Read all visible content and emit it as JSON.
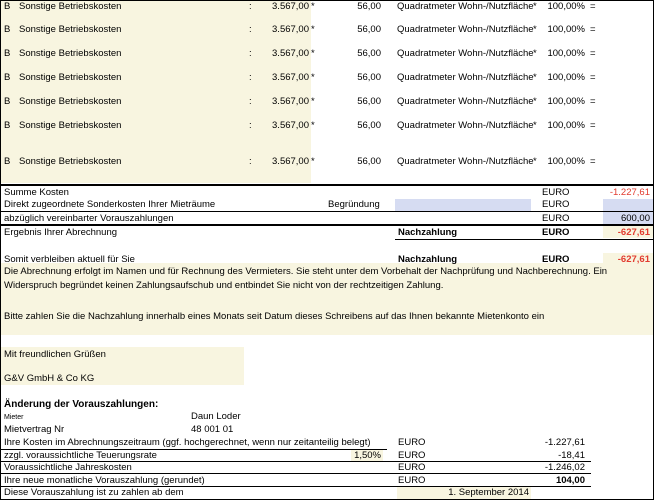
{
  "cost_rows": [
    {
      "code": "B",
      "label": "Sonstige Betriebskosten",
      "colon": ":",
      "amount": "3.567,00",
      "op": "*",
      "factor": "56,00",
      "basis": "Quadratmeter Wohn-/Nutzfläche",
      "op2": "*",
      "percent": "100,00%",
      "eq": "="
    },
    {
      "code": "B",
      "label": "Sonstige Betriebskosten",
      "colon": ":",
      "amount": "3.567,00",
      "op": "*",
      "factor": "56,00",
      "basis": "Quadratmeter Wohn-/Nutzfläche",
      "op2": "*",
      "percent": "100,00%",
      "eq": "="
    },
    {
      "code": "B",
      "label": "Sonstige Betriebskosten",
      "colon": ":",
      "amount": "3.567,00",
      "op": "*",
      "factor": "56,00",
      "basis": "Quadratmeter Wohn-/Nutzfläche",
      "op2": "*",
      "percent": "100,00%",
      "eq": "="
    },
    {
      "code": "B",
      "label": "Sonstige Betriebskosten",
      "colon": ":",
      "amount": "3.567,00",
      "op": "*",
      "factor": "56,00",
      "basis": "Quadratmeter Wohn-/Nutzfläche",
      "op2": "*",
      "percent": "100,00%",
      "eq": "="
    },
    {
      "code": "B",
      "label": "Sonstige Betriebskosten",
      "colon": ":",
      "amount": "3.567,00",
      "op": "*",
      "factor": "56,00",
      "basis": "Quadratmeter Wohn-/Nutzfläche",
      "op2": "*",
      "percent": "100,00%",
      "eq": "="
    },
    {
      "code": "B",
      "label": "Sonstige Betriebskosten",
      "colon": ":",
      "amount": "3.567,00",
      "op": "*",
      "factor": "56,00",
      "basis": "Quadratmeter Wohn-/Nutzfläche",
      "op2": "*",
      "percent": "100,00%",
      "eq": "="
    },
    {
      "code": "B",
      "label": "Sonstige Betriebskosten",
      "colon": ":",
      "amount": "3.567,00",
      "op": "*",
      "factor": "56,00",
      "basis": "Quadratmeter Wohn-/Nutzfläche",
      "op2": "*",
      "percent": "100,00%",
      "eq": "="
    }
  ],
  "summary": {
    "sum_label": "Summe Kosten",
    "sum_currency": "EURO",
    "sum_value": "-1.227,61",
    "direct_label": "Direkt zugeordnete Sonderkosten Ihrer Mieträume",
    "reason_label": "Begründung",
    "direct_currency": "EURO",
    "prepay_label": "abzüglich vereinbarter Vorauszahlungen",
    "prepay_currency": "EURO",
    "prepay_value": "600,00",
    "result_label": "Ergebnis Ihrer Abrechnung",
    "result_type": "Nachzahlung",
    "result_currency": "EURO",
    "result_value": "-627,61",
    "remain_label": "Somit verbleiben aktuell für Sie",
    "remain_type": "Nachzahlung",
    "remain_currency": "EURO",
    "remain_value": "-627,61"
  },
  "notice": {
    "line1": "Die Abrechnung erfolgt im Namen und für Rechnung des Vermieters. Sie steht unter dem Vorbehalt der Nachprüfung und Nachberechnung. Ein",
    "line2": "Widerspruch begründet keinen Zahlungsaufschub und entbindet Sie nicht von der rechtzeitigen Zahlung.",
    "payment": "Bitte zahlen Sie die Nachzahlung innerhalb eines Monats seit Datum dieses Schreibens auf das Ihnen bekannte Mietenkonto ein"
  },
  "closing": {
    "greeting": "Mit freundlichen Grüßen",
    "company": "G&V GmbH & Co KG"
  },
  "prepayment_change": {
    "title": "Änderung der Vorauszahlungen:",
    "tenant_label": "Mieter",
    "tenant_value": "Daun Loder",
    "contract_label": "Mietvertrag Nr",
    "contract_value": "48 001 01",
    "costs_label": "Ihre Kosten im Abrechnungszeitraum (ggf. hochgerechnet, wenn nur zeitanteilig belegt)",
    "costs_currency": "EURO",
    "costs_value": "-1.227,61",
    "inflation_label": "zzgl. voraussichtliche Teuerungsrate",
    "inflation_rate": "1,50%",
    "inflation_currency": "EURO",
    "inflation_value": "-18,41",
    "annual_label": "Voraussichtliche Jahreskosten",
    "annual_currency": "EURO",
    "annual_value": "-1.246,02",
    "monthly_label": "Ihre neue monatliche Vorauszahlung (gerundet)",
    "monthly_currency": "EURO",
    "monthly_value": "104,00",
    "start_label": "Diese Vorauszahlung ist zu zahlen ab dem",
    "start_date": "1. September 2014"
  }
}
